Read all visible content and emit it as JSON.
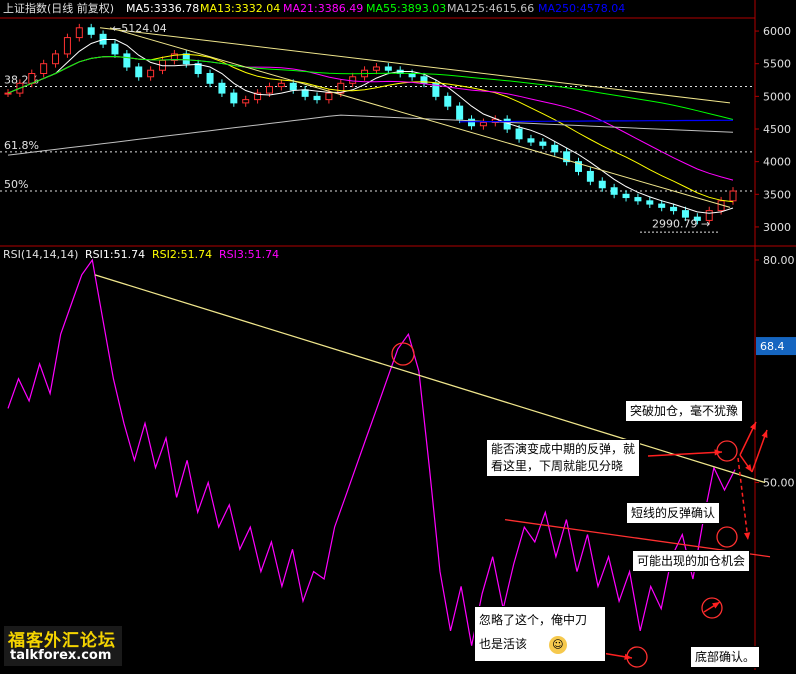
{
  "top_legend": {
    "title": "上证指数(日线 前复权)",
    "ma5": "MA5:3336.78",
    "ma13": "MA13:3332.04",
    "ma21": "MA21:3386.49",
    "ma55": "MA55:3893.03",
    "ma125": "MA125:4615.66",
    "ma250": "MA250:4578.04",
    "colors": {
      "ma5": "#ffffff",
      "ma13": "#ffff00",
      "ma21": "#ff00ff",
      "ma55": "#00ff00",
      "ma125": "#c0c0c0",
      "ma250": "#0000ff"
    }
  },
  "bottom_legend": {
    "title": "RSI(14,14,14)",
    "rsi1": "RSI1:51.74",
    "rsi2": "RSI2:51.74",
    "rsi3": "RSI3:51.74"
  },
  "price_labels": {
    "high": "5124.04",
    "low": "2990.79",
    "fib_a": "38.2%",
    "fib_b": "61.8%",
    "fib_c": "50%"
  },
  "current_rsi_badge": "68.4",
  "annotations": {
    "breakout": "突破加仓，毫不犹豫",
    "watch_line1": "能否演变成中期的反弹，就",
    "watch_line2": "看这里，下周就能见分晓",
    "short_rebound": "短线的反弹确认",
    "add_chance": "可能出现的加仓机会",
    "ignored_line1": "忽略了这个，俺中刀",
    "ignored_line2": "也是活该",
    "bottom_confirm": "底部确认。"
  },
  "watermark": {
    "line1": "福客外汇论坛",
    "line2": "talkforex.com"
  },
  "chart_data": [
    {
      "type": "candlestick",
      "title": "上证指数(日线 前复权)",
      "ylim": [
        2800,
        6200
      ],
      "yticks": [
        "3000",
        "3500",
        "4000",
        "4500",
        "5000",
        "5500",
        "6000"
      ],
      "grid": false,
      "series": [
        {
          "name": "MA5",
          "last": 3336.78
        },
        {
          "name": "MA13",
          "last": 3332.04
        },
        {
          "name": "MA21",
          "last": 3386.49
        },
        {
          "name": "MA55",
          "last": 3893.03
        },
        {
          "name": "MA125",
          "last": 4615.66
        },
        {
          "name": "MA250",
          "last": 4578.04
        }
      ],
      "price_close": [
        5050,
        5200,
        5350,
        5500,
        5650,
        5900,
        6050,
        5950,
        5800,
        5650,
        5450,
        5300,
        5400,
        5550,
        5650,
        5500,
        5350,
        5200,
        5050,
        4900,
        4950,
        5050,
        5150,
        5200,
        5100,
        5000,
        4950,
        5050,
        5200,
        5300,
        5400,
        5450,
        5400,
        5350,
        5300,
        5200,
        5000,
        4850,
        4650,
        4550,
        4600,
        4650,
        4500,
        4350,
        4300,
        4250,
        4150,
        4000,
        3850,
        3700,
        3600,
        3500,
        3450,
        3400,
        3350,
        3300,
        3250,
        3150,
        3100,
        3250,
        3400,
        3550
      ],
      "annotated_values": {
        "high": 5124.04,
        "low": 2990.79
      },
      "levels": [
        "38.2%",
        "61.8%",
        "50%"
      ]
    },
    {
      "type": "line",
      "title": "RSI(14,14,14)",
      "ylim": [
        25,
        80
      ],
      "yticks": [
        "50.00",
        "80.00"
      ],
      "grid": false,
      "series": [
        {
          "name": "RSI1",
          "last": 51.74,
          "values": [
            60,
            64,
            61,
            66,
            62,
            70,
            74,
            78,
            80,
            72,
            64,
            58,
            53,
            58,
            52,
            56,
            48,
            53,
            46,
            50,
            44,
            47,
            41,
            44,
            38,
            42,
            36,
            41,
            34,
            38,
            37,
            44,
            48,
            52,
            56,
            60,
            64,
            68,
            70,
            65,
            52,
            38,
            30,
            36,
            28,
            35,
            40,
            33,
            39,
            44,
            42,
            46,
            40,
            45,
            38,
            43,
            36,
            40,
            34,
            38,
            30,
            36,
            33,
            40,
            43,
            37,
            45,
            52,
            49,
            51.74
          ]
        }
      ],
      "current_value": 68.4
    }
  ]
}
